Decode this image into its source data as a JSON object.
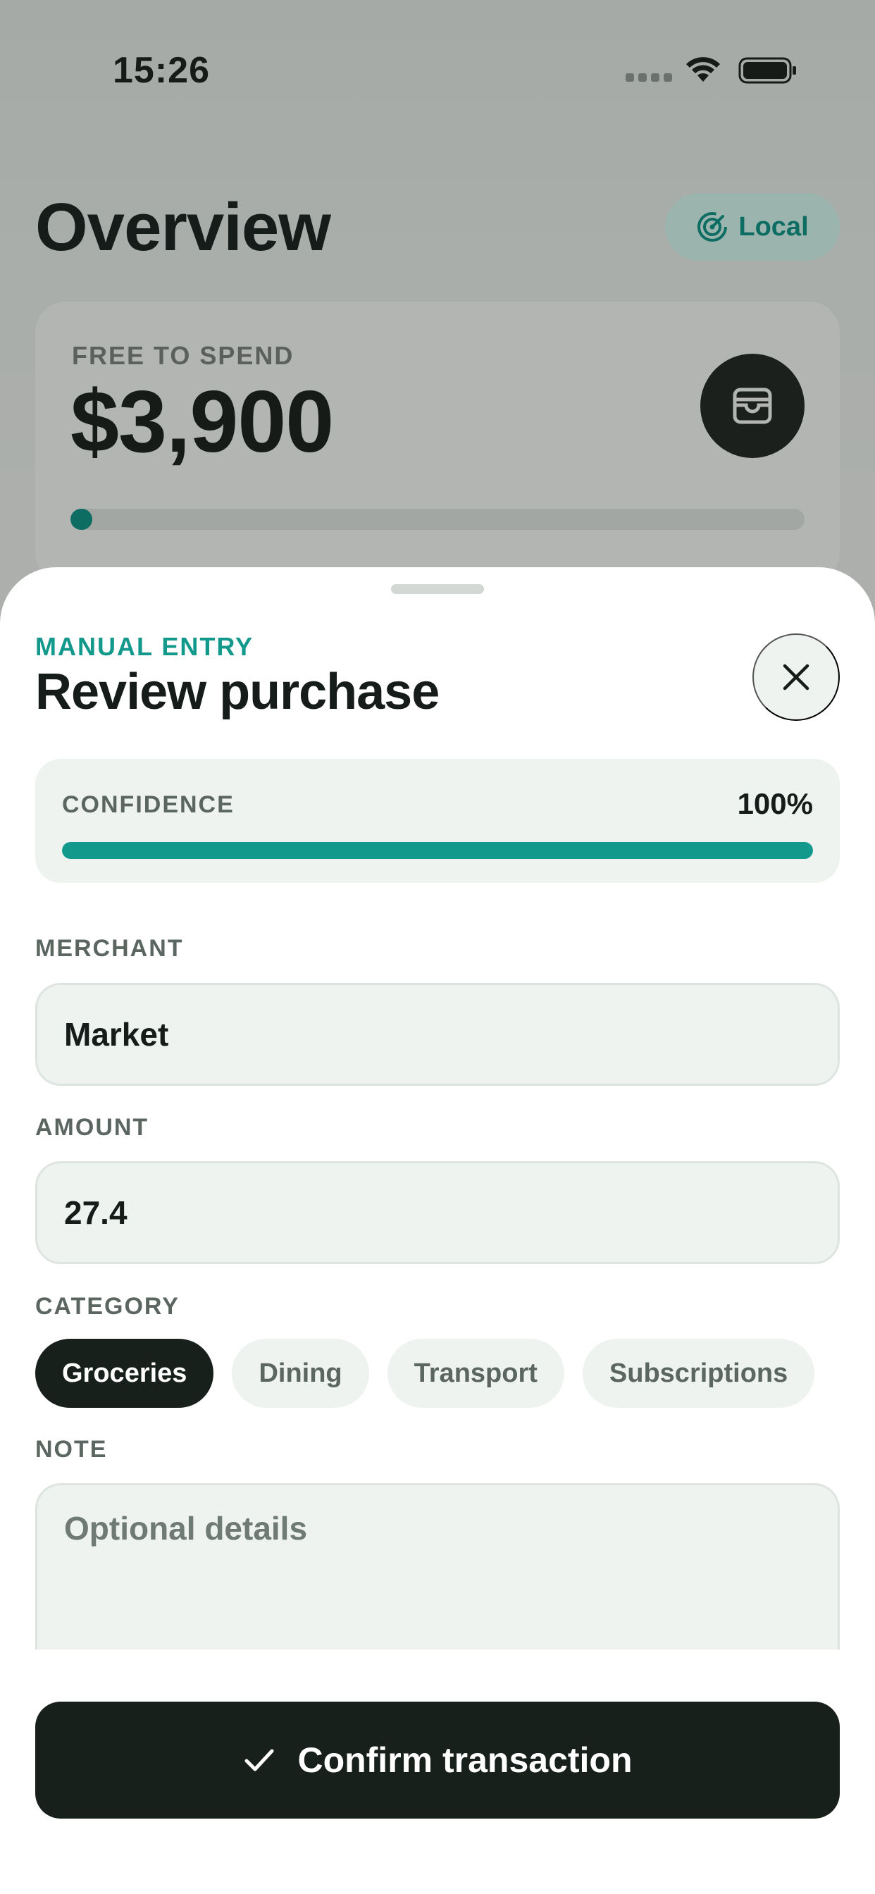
{
  "status_bar": {
    "time": "15:26",
    "wifi_icon": "wifi-icon",
    "battery_icon": "battery-full-icon"
  },
  "header": {
    "title": "Overview",
    "mode_pill": {
      "label": "Local",
      "icon": "radar-icon",
      "color": "#0e6d63"
    }
  },
  "spend_card": {
    "label": "FREE TO SPEND",
    "amount": "$3,900",
    "wallet_icon": "wallet-icon",
    "progress_fraction": 0.03
  },
  "sheet": {
    "eyebrow": "MANUAL ENTRY",
    "title": "Review purchase",
    "close_icon": "close-icon",
    "confidence": {
      "label": "CONFIDENCE",
      "value_text": "100%",
      "fraction": 1.0
    },
    "merchant": {
      "label": "MERCHANT",
      "value": "Market"
    },
    "amount": {
      "label": "AMOUNT",
      "value": "27.4"
    },
    "category": {
      "label": "CATEGORY",
      "options": [
        "Groceries",
        "Dining",
        "Transport",
        "Subscriptions"
      ],
      "selected": "Groceries"
    },
    "note": {
      "label": "NOTE",
      "placeholder": "Optional details",
      "value": ""
    },
    "confirm": {
      "label": "Confirm transaction",
      "icon": "checkmark-icon"
    }
  },
  "colors": {
    "accent": "#12998b",
    "accent_dark": "#0e6d63",
    "ink": "#161c19",
    "surface": "#eef3f0"
  }
}
